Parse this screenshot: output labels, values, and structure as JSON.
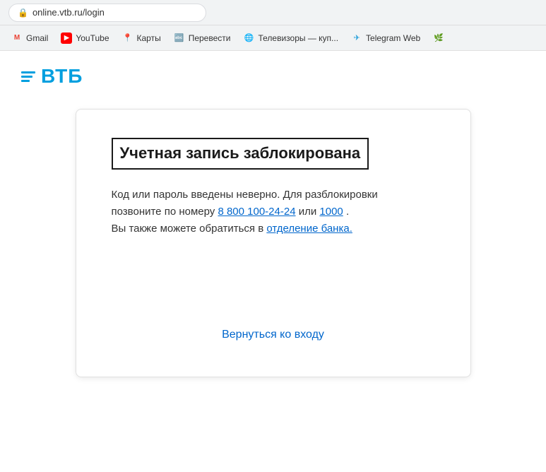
{
  "browser": {
    "address": "online.vtb.ru/login",
    "lock_symbol": "🔒"
  },
  "bookmarks": [
    {
      "id": "gmail",
      "label": "Gmail",
      "icon_type": "gmail"
    },
    {
      "id": "youtube",
      "label": "YouTube",
      "icon_type": "youtube"
    },
    {
      "id": "maps",
      "label": "Карты",
      "icon_type": "maps"
    },
    {
      "id": "translate",
      "label": "Перевести",
      "icon_type": "translate"
    },
    {
      "id": "tv",
      "label": "Телевизоры — куп...",
      "icon_type": "globe"
    },
    {
      "id": "telegram",
      "label": "Telegram Web",
      "icon_type": "telegram"
    },
    {
      "id": "other",
      "label": "",
      "icon_type": "green"
    }
  ],
  "vtb": {
    "logo_text": "ВТБ"
  },
  "card": {
    "title": "Учетная запись заблокирована",
    "body_line1": "Код или пароль введены неверно. Для разблокировки",
    "body_line2": "позвоните по номеру",
    "phone1": "8 800 100-24-24",
    "body_line3": "или",
    "phone2": "1000",
    "body_line4": ".",
    "body_line5": "Вы также можете обратиться в",
    "branch_link": "отделение банка.",
    "back_button": "Вернуться ко входу"
  }
}
